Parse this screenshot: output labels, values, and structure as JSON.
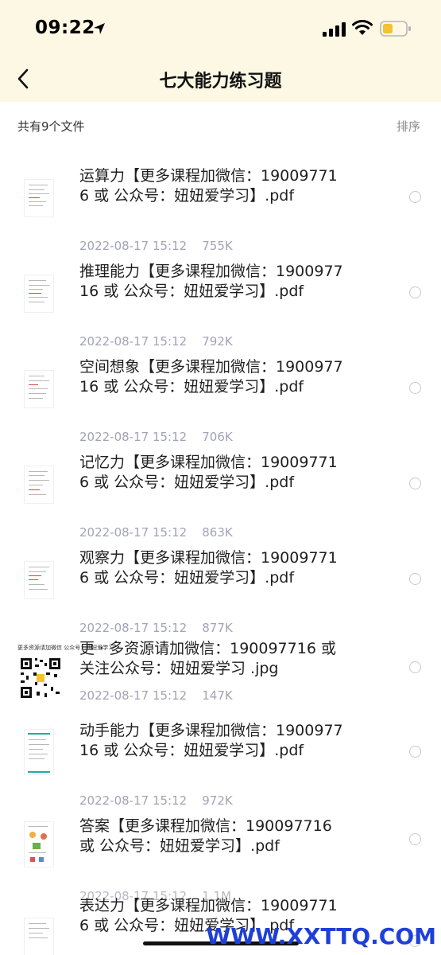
{
  "status": {
    "time": "09:22"
  },
  "nav": {
    "title": "七大能力练习题",
    "back_icon": "chevron-left-icon"
  },
  "list_header": {
    "count_text": "共有9个文件",
    "sort_label": "排序"
  },
  "files": [
    {
      "name": "运算力【更多课程加微信：190097716 或 公众号：妞妞爱学习】.pdf",
      "meta": "2022-08-17 15:12    755K"
    },
    {
      "name": "推理能力【更多课程加微信：190097716 或 公众号：妞妞爱学习】.pdf",
      "meta": "2022-08-17 15:12    792K"
    },
    {
      "name": "空间想象【更多课程加微信：190097716 或 公众号：妞妞爱学习】.pdf",
      "meta": "2022-08-17 15:12    706K"
    },
    {
      "name": "记忆力【更多课程加微信：190097716 或 公众号：妞妞爱学习】.pdf",
      "meta": "2022-08-17 15:12    863K"
    },
    {
      "name": "观察力【更多课程加微信：190097716 或 公众号：妞妞爱学习】.pdf",
      "meta": "2022-08-17 15:12    877K"
    },
    {
      "name": "更 · 多资源请加微信：190097716 或关注公众号：妞妞爱学习 .jpg",
      "meta": "2022-08-17 15:12    147K",
      "thumb_caption": "更多资源请加微信 公众号：妞妞爱学习"
    },
    {
      "name": "动手能力【更多课程加微信：190097716 或 公众号：妞妞爱学习】.pdf",
      "meta": "2022-08-17 15:12    972K"
    },
    {
      "name": "答案【更多课程加微信：190097716 或 公众号：妞妞爱学习】.pdf",
      "meta": "2022-08-17 15:12    1.1M"
    },
    {
      "name": "表达力【更多课程加微信：190097716 或 公众号：妞妞爱学习】.pdf",
      "meta": ""
    }
  ],
  "watermark": "WWW.XXTTQ.COM",
  "colors": {
    "header_bg": "#fdf8e4",
    "meta_text": "#a3a3b5",
    "watermark": "#1e3fd8"
  }
}
